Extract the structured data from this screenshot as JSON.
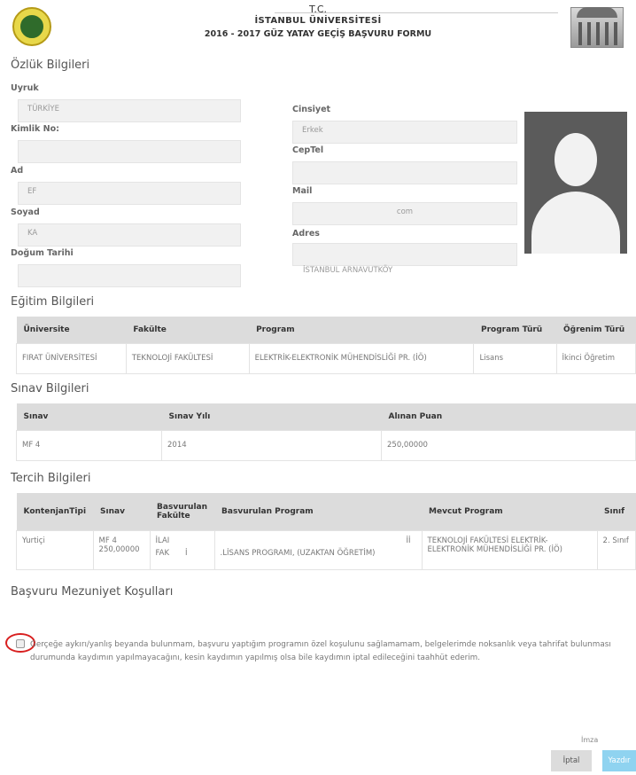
{
  "header": {
    "tc": "T.C.",
    "university": "İSTANBUL ÜNİVERSİTESİ",
    "form_title": "2016 - 2017 GÜZ YATAY GEÇİŞ BAŞVURU FORMU"
  },
  "personal": {
    "title": "Özlük Bilgileri",
    "uyruk_label": "Uyruk",
    "uyruk_value": "TÜRKİYE",
    "kimlik_label": "Kimlik No:",
    "kimlik_value": "",
    "ad_label": "Ad",
    "ad_value": "EF",
    "soyad_label": "Soyad",
    "soyad_value": "KA",
    "dogum_label": "Doğum Tarihi",
    "dogum_value": "",
    "cinsiyet_label": "Cinsiyet",
    "cinsiyet_value": "Erkek",
    "ceptel_label": "CepTel",
    "ceptel_value": "",
    "mail_label": "Mail",
    "mail_value": "com",
    "adres_label": "Adres",
    "adres_value": "İSTANBUL ARNAVUTKÖY"
  },
  "education": {
    "title": "Eğitim Bilgileri",
    "headers": [
      "Üniversite",
      "Fakülte",
      "Program",
      "Program Türü",
      "Öğrenim Türü"
    ],
    "row": [
      "FIRAT ÜNİVERSİTESİ",
      "TEKNOLOJİ FAKÜLTESİ",
      "ELEKTRİK-ELEKTRONİK MÜHENDİSLİĞİ PR. (İÖ)",
      "Lisans",
      "İkinci Öğretim"
    ]
  },
  "exam": {
    "title": "Sınav Bilgileri",
    "headers": [
      "Sınav",
      "Sınav Yılı",
      "Alınan Puan"
    ],
    "row": [
      "MF 4",
      "2014",
      "250,00000"
    ]
  },
  "preference": {
    "title": "Tercih Bilgileri",
    "headers": [
      "KontenjanTipi",
      "Sınav",
      "Basvurulan Fakülte",
      "Basvurulan Program",
      "Mevcut Program",
      "Sınıf"
    ],
    "row": {
      "kontenjan": "Yurtiçi",
      "sinav": "MF 4 250,00000",
      "fakulte_1": "İLAI",
      "fakulte_2": "FAK",
      "fakulte_3": "İ",
      "program_1": "İİ",
      "program_2": ".LİSANS PROGRAMI, (UZAKTAN ÖĞRETİM)",
      "mevcut": "TEKNOLOJİ FAKÜLTESİ ELEKTRİK-ELEKTRONİK MÜHENDİSLİĞİ PR. (İÖ)",
      "sinif": "2. Sınıf"
    }
  },
  "conditions": {
    "title": "Başvuru Mezuniyet Koşulları",
    "text": "Gerçeğe aykırı/yanlış beyanda bulunmam, başvuru yaptığım programın özel koşulunu sağlamamam, belgelerimde noksanlık veya tahrifat bulunması durumunda kaydımın yapılmayacağını, kesin kaydımın yapılmış olsa bile kaydımın iptal edileceğini taahhüt ederim.",
    "checked": false
  },
  "footer": {
    "imza": "İmza",
    "cancel": "İptal",
    "print": "Yazdır"
  },
  "colors": {
    "accent_print": "#8fd3f0",
    "highlight_circle": "#d81f1f"
  }
}
